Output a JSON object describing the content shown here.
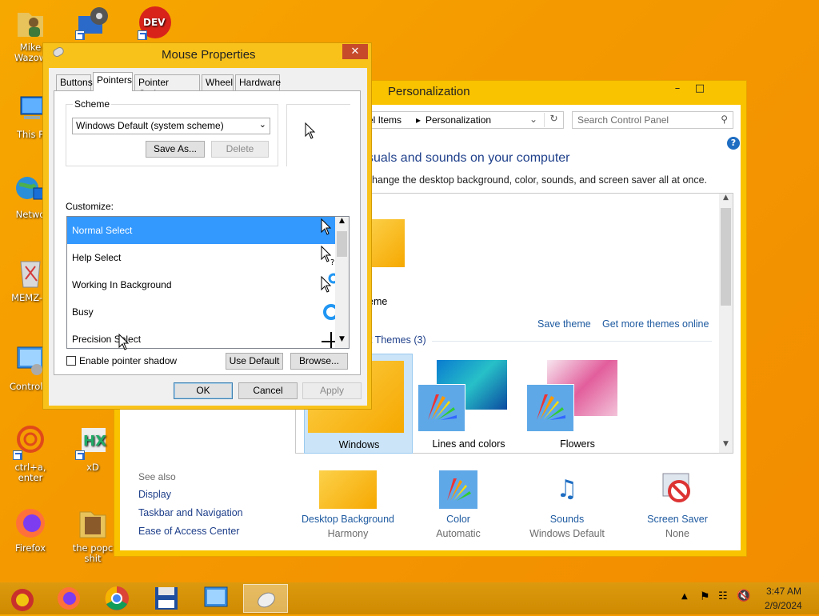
{
  "desktop": {
    "icons": [
      {
        "label": "Mike Wazow",
        "icon": "user-folder-icon"
      },
      {
        "label": "This P",
        "icon": "computer-icon"
      },
      {
        "label": "Netwo",
        "icon": "network-icon"
      },
      {
        "label": "MEMZ-D",
        "icon": "recycle-bin-icon"
      },
      {
        "label": "Control P",
        "icon": "control-panel-icon"
      },
      {
        "label": "ctrl+a, enter",
        "icon": "ring-icon"
      },
      {
        "label": "xD",
        "icon": "hxd-icon"
      },
      {
        "label": "Firefox",
        "icon": "firefox-icon"
      },
      {
        "label": "the popc shit",
        "icon": "folder-icon"
      },
      {
        "label": "DEV C++",
        "icon": "devcpp-icon"
      }
    ]
  },
  "personalization": {
    "title": "Personalization",
    "address_items": "el Items",
    "address_current": "Personalization",
    "search_placeholder": "Search Control Panel",
    "heading": "suals and sounds on your computer",
    "subheading": "hange the desktop background, color, sounds, and screen saver all at once.",
    "my_theme_label": "eme",
    "save_theme": "Save theme",
    "get_more_themes": "Get more themes online",
    "installed_themes": "t Themes (3)",
    "themes": [
      "Windows",
      "Lines and colors",
      "Flowers"
    ],
    "see_also": {
      "label": "See also",
      "links": [
        "Display",
        "Taskbar and Navigation",
        "Ease of Access Center"
      ]
    },
    "bottom": [
      {
        "label": "Desktop Background",
        "value": "Harmony"
      },
      {
        "label": "Color",
        "value": "Automatic"
      },
      {
        "label": "Sounds",
        "value": "Windows Default"
      },
      {
        "label": "Screen Saver",
        "value": "None"
      }
    ]
  },
  "mouse_properties": {
    "title": "Mouse Properties",
    "tabs": [
      "Buttons",
      "Pointers",
      "Pointer Options",
      "Wheel",
      "Hardware"
    ],
    "active_tab": "Pointers",
    "scheme_label": "Scheme",
    "scheme_value": "Windows Default (system scheme)",
    "save_as": "Save As...",
    "delete": "Delete",
    "customize_label": "Customize:",
    "pointers": [
      "Normal Select",
      "Help Select",
      "Working In Background",
      "Busy",
      "Precision Select"
    ],
    "enable_shadow": "Enable pointer shadow",
    "use_default": "Use Default",
    "browse": "Browse...",
    "ok": "OK",
    "cancel": "Cancel",
    "apply": "Apply"
  },
  "taskbar": {
    "time": "3:47 AM",
    "date": "2/9/2024"
  },
  "colors": {
    "desktop": "#f49a00",
    "window_frame": "#f9c21b",
    "selection": "#3399ff",
    "close_button": "#c74a2a"
  }
}
